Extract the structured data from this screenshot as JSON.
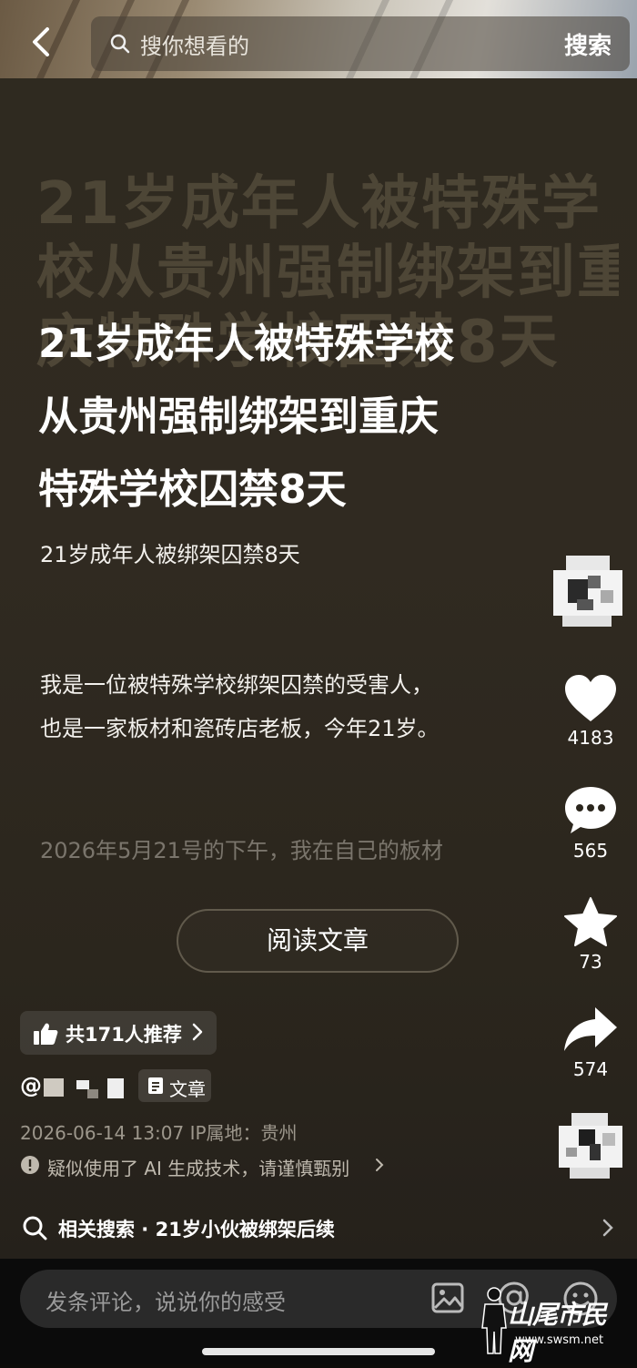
{
  "search": {
    "placeholder": "搜你想看的",
    "button": "搜索"
  },
  "card": {
    "ghost_lines": [
      "21岁成年人被特殊学",
      "校从贵州强制绑架到重",
      "庆特殊学校囚禁8天"
    ],
    "title_lines": [
      "21岁成年人被特殊学校",
      "从贵州强制绑架到重庆",
      "特殊学校囚禁8天"
    ],
    "subtitle": "21岁成年人被绑架囚禁8天",
    "body_lines": [
      "我是一位被特殊学校绑架囚禁的受害人，",
      "也是一家板材和瓷砖店老板，今年21岁。"
    ],
    "faded_line": "2026年5月21号的下午，我在自己的板材",
    "read_button": "阅读文章"
  },
  "actions": {
    "likes": "4183",
    "comments": "565",
    "favorites": "73",
    "shares": "574"
  },
  "post": {
    "recommend": "共171人推荐",
    "author_prefix": "@",
    "tag": "文章",
    "meta": "2026-06-14 13:07  IP属地：贵州",
    "ai_note": "疑似使用了 AI 生成技术，请谨慎甄别",
    "related": "相关搜索 · 21岁小伙被绑架后续"
  },
  "comment": {
    "placeholder": "发条评论，说说你的感受"
  },
  "watermark": {
    "name": "山尾市民网",
    "url": "www.swsm.net"
  },
  "colors": {
    "card_bg": "#2f2a20",
    "ghost": "#736952",
    "muted": "#9d978c"
  }
}
